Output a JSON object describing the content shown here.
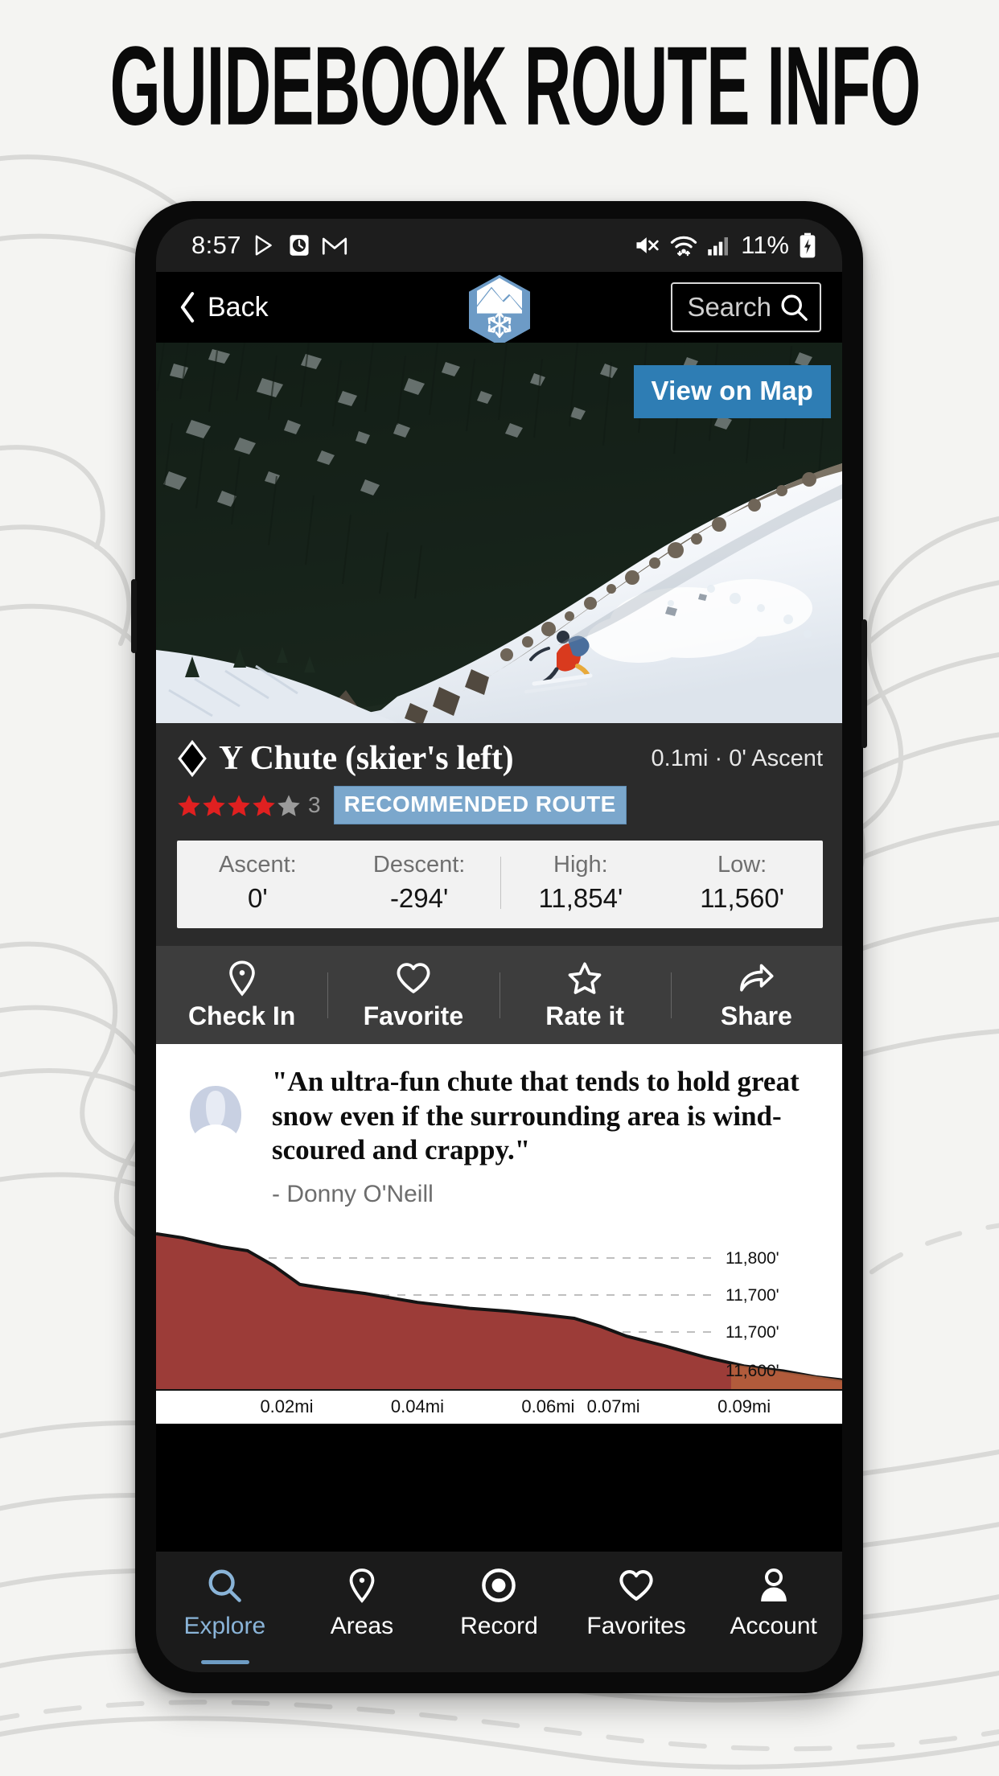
{
  "poster": {
    "headline": "GUIDEBOOK ROUTE INFO",
    "background_color": "#f4f4f2"
  },
  "status_bar": {
    "time": "8:57",
    "left_icons": [
      "play-store-icon",
      "clock-icon",
      "gmail-icon"
    ],
    "right_icons": [
      "mute-icon",
      "wifi-icon",
      "signal-icon"
    ],
    "battery_percent": "11%",
    "battery_icon": "battery-charging-icon"
  },
  "app_bar": {
    "back_label": "Back",
    "back_icon": "chevron-left-icon",
    "logo_icon": "mountain-snowflake-logo",
    "search_placeholder": "Search",
    "search_icon": "search-icon"
  },
  "hero": {
    "photo_alt": "skier descending snowy chute",
    "view_on_map_label": "View on Map",
    "view_on_map_color": "#2e7db4"
  },
  "route": {
    "difficulty_icon": "black-diamond-icon",
    "title": "Y Chute (skier's left)",
    "distance_ascent": "0.1mi · 0' Ascent",
    "rating_stars_filled": 4,
    "rating_stars_total": 5,
    "rating_count": "3",
    "badge_label": "RECOMMENDED ROUTE",
    "badge_color": "#7ba7cc",
    "star_color": "#e02020"
  },
  "stats": [
    {
      "label": "Ascent:",
      "value": "0'"
    },
    {
      "label": "Descent:",
      "value": "-294'"
    },
    {
      "label": "High:",
      "value": "11,854'"
    },
    {
      "label": "Low:",
      "value": "11,560'"
    }
  ],
  "actions": [
    {
      "label": "Check In",
      "icon": "map-pin-icon"
    },
    {
      "label": "Favorite",
      "icon": "heart-icon"
    },
    {
      "label": "Rate it",
      "icon": "star-outline-icon"
    },
    {
      "label": "Share",
      "icon": "share-arrow-icon"
    }
  ],
  "quote": {
    "avatar_icon": "person-avatar-placeholder",
    "text": "\"An ultra-fun chute that tends to hold great snow even if the surrounding area is wind-scoured and crappy.\"",
    "author": "- Donny O'Neill"
  },
  "chart_data": {
    "type": "area",
    "title": "",
    "xlabel": "",
    "ylabel": "",
    "fill_color": "#9c3c38",
    "line_color": "#141414",
    "grid": true,
    "ytick_labels": [
      "11,800'",
      "11,700'",
      "11,700'",
      "11,600'"
    ],
    "ytick_values": [
      11800,
      11700,
      11700,
      11600
    ],
    "xtick_labels": [
      "0.02mi",
      "0.04mi",
      "0.06mi",
      "0.07mi",
      "0.09mi"
    ],
    "xtick_values": [
      0.02,
      0.04,
      0.06,
      0.07,
      0.09
    ],
    "xlim": [
      0.0,
      0.105
    ],
    "ylim": [
      11540,
      11870
    ],
    "x": [
      0.0,
      0.004,
      0.01,
      0.014,
      0.018,
      0.022,
      0.026,
      0.032,
      0.04,
      0.048,
      0.054,
      0.06,
      0.064,
      0.068,
      0.072,
      0.078,
      0.084,
      0.09,
      0.096,
      0.101,
      0.105
    ],
    "y": [
      11854,
      11846,
      11828,
      11820,
      11790,
      11752,
      11744,
      11734,
      11716,
      11704,
      11698,
      11690,
      11684,
      11668,
      11648,
      11628,
      11606,
      11588,
      11578,
      11566,
      11560
    ]
  },
  "bottom_nav": {
    "active_color": "#8ab4d8",
    "items": [
      {
        "label": "Explore",
        "icon": "search-icon",
        "active": true
      },
      {
        "label": "Areas",
        "icon": "map-pin-icon",
        "active": false
      },
      {
        "label": "Record",
        "icon": "record-icon",
        "active": false
      },
      {
        "label": "Favorites",
        "icon": "heart-icon",
        "active": false
      },
      {
        "label": "Account",
        "icon": "person-icon",
        "active": false
      }
    ]
  }
}
